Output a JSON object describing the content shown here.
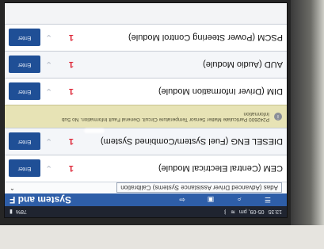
{
  "statusbar": {
    "time": "13:35",
    "date": "05-09, pm",
    "battery": "78%",
    "icons": [
      "wifi-icon",
      "bluetooth-icon",
      "settings-icon"
    ]
  },
  "toolbar": {
    "title": "System and F",
    "buttons": [
      "menu-icon",
      "search-icon",
      "save-icon",
      "back-icon"
    ]
  },
  "calibration": {
    "label": "Adas (Advanced Driver Assistance Systems) Calibration"
  },
  "modules": [
    {
      "name": "CEM (Central Electrical Module)",
      "value": "1",
      "action": "Enter"
    },
    {
      "name": "DIESEL ENG (Fuel System/Combined System)",
      "value": "1",
      "action": "Enter"
    },
    {
      "name": "DIM (Driver Information Module)",
      "value": "1",
      "action": "Enter"
    },
    {
      "name": "AUD (Audio Module)",
      "value": "1",
      "action": "Enter"
    },
    {
      "name": "PSCM (Power Steering Control Module)",
      "value": "1",
      "action": "Enter"
    }
  ],
  "fault": {
    "text": "P242600 Particulate Matter Sensor Temperature Circuit. General Fault Information. No Sub",
    "subtext": "Information"
  }
}
